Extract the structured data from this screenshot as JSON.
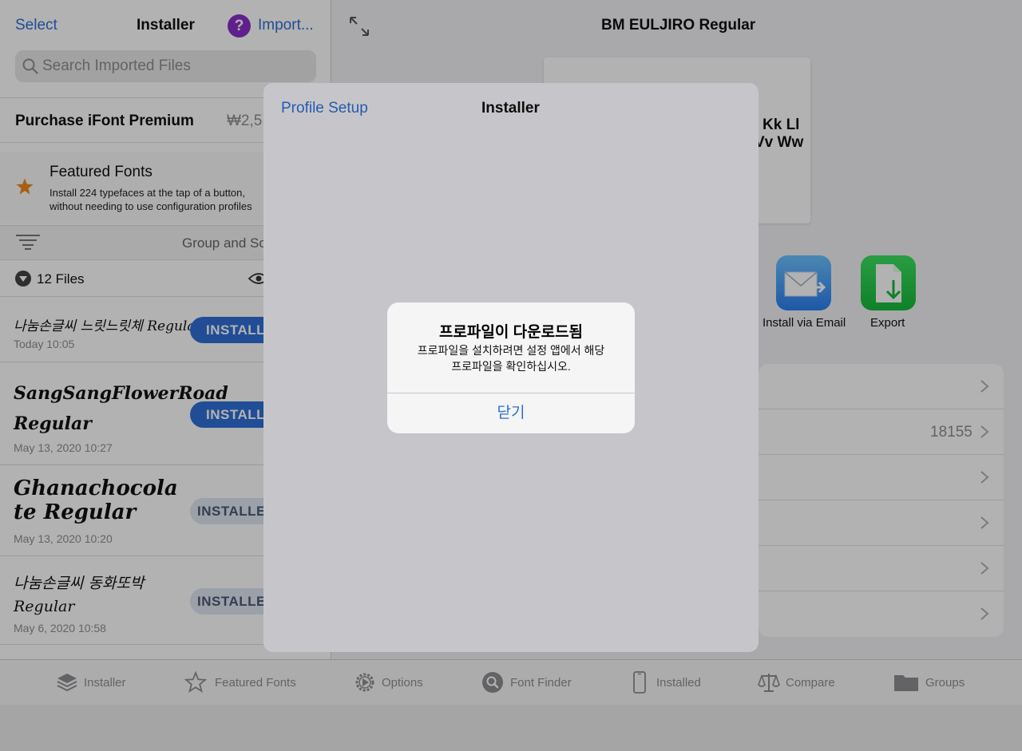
{
  "sidebar": {
    "select_label": "Select",
    "title": "Installer",
    "help_glyph": "?",
    "import_label": "Import...",
    "search": {
      "placeholder": "Search Imported Files"
    },
    "premium": {
      "label": "Purchase iFont Premium",
      "price": "₩2,5"
    },
    "featured": {
      "title": "Featured Fonts",
      "desc_line1": "Install 224 typefaces at the tap of a button,",
      "desc_line2": "without needing to use configuration profiles"
    },
    "group_label": "Group and So",
    "files_count": "12 Files",
    "files": [
      {
        "name": "나눔손글씨 느릿느릿체 Regular",
        "date": "Today 10:05",
        "button": "INSTALL"
      },
      {
        "name": "SangSangFlowerRoad Regular",
        "date": "May 13, 2020 10:27",
        "button": "INSTALL"
      },
      {
        "name": "Ghanachocolate Regular",
        "date": "May 13, 2020 10:20",
        "button": "INSTALLE"
      },
      {
        "name": "나눔손글씨 동화또박 Regular",
        "date": "May 6, 2020 10:58",
        "button": "INSTALLE"
      }
    ]
  },
  "main": {
    "title": "BM EULJIRO Regular",
    "preview_line1": "Kk Ll",
    "preview_line2": "Vv Ww",
    "actions": {
      "email_label": "Install via Email",
      "export_label": "Export"
    },
    "row_value": "18155"
  },
  "tabs": [
    {
      "label": "Installer",
      "icon": "layers-icon"
    },
    {
      "label": "Featured Fonts",
      "icon": "star-icon"
    },
    {
      "label": "Options",
      "icon": "gear-icon"
    },
    {
      "label": "Font Finder",
      "icon": "magnifier-icon"
    },
    {
      "label": "Installed",
      "icon": "phone-icon"
    },
    {
      "label": "Compare",
      "icon": "scale-icon"
    },
    {
      "label": "Groups",
      "icon": "folder-icon"
    }
  ],
  "sheet": {
    "left_label": "Profile Setup",
    "title": "Installer"
  },
  "alert": {
    "title": "프로파일이 다운로드됨",
    "message_line1": "프로파일을 설치하려면 설정 앱에서 해당",
    "message_line2": "프로파일을 확인하십시오.",
    "button": "닫기"
  },
  "colors": {
    "accent": "#2f6fd6",
    "install_button": "#2f6fd6",
    "help_purple": "#8a2fc9",
    "export_green": "#15b93c"
  }
}
